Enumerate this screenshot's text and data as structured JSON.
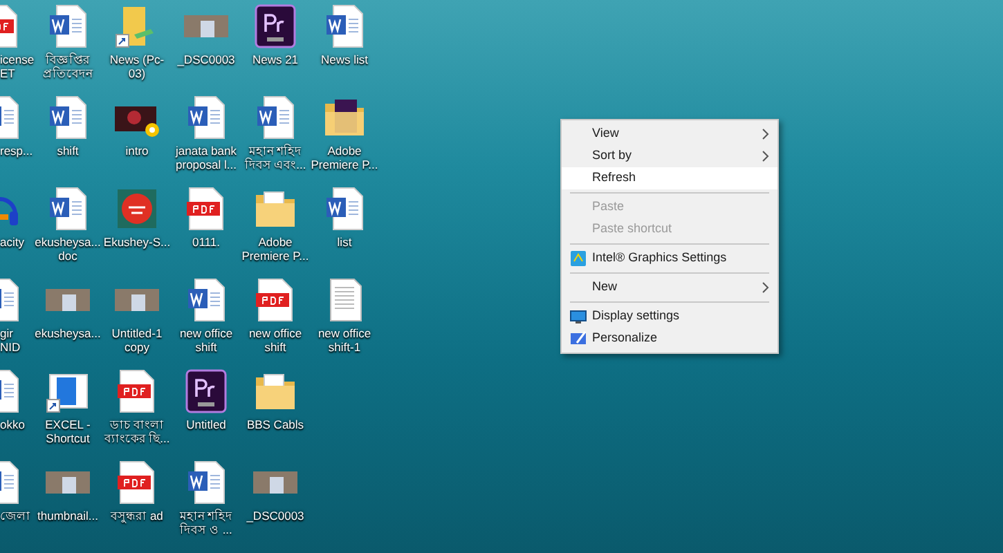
{
  "desktop_icons": [
    [
      {
        "kind": "pdf",
        "label": "icense ET"
      },
      {
        "kind": "word",
        "label": "বিজ্ঞপ্তির প্রতিবেদন"
      },
      {
        "kind": "shortcut-folder",
        "label": "News (Pc-03)"
      },
      {
        "kind": "photo",
        "label": "_DSC0003"
      },
      {
        "kind": "premiere",
        "label": "News 21"
      },
      {
        "kind": "word",
        "label": "News list"
      }
    ],
    [
      {
        "kind": "word",
        "label": "resp..."
      },
      {
        "kind": "word",
        "label": "shift"
      },
      {
        "kind": "video",
        "label": "intro"
      },
      {
        "kind": "word",
        "label": "janata bank proposal l..."
      },
      {
        "kind": "word",
        "label": "মহান শহিদ দিবস এবং..."
      },
      {
        "kind": "premiere-folder",
        "label": "Adobe Premiere P..."
      }
    ],
    [
      {
        "kind": "audio",
        "label": "acity"
      },
      {
        "kind": "word",
        "label": "ekusheysa... doc"
      },
      {
        "kind": "app",
        "label": "Ekushey-S..."
      },
      {
        "kind": "pdf",
        "label": "0111."
      },
      {
        "kind": "folder",
        "label": "Adobe Premiere P..."
      },
      {
        "kind": "word",
        "label": "list"
      }
    ],
    [
      {
        "kind": "word",
        "label": "gir NID"
      },
      {
        "kind": "photo",
        "label": "ekusheysa..."
      },
      {
        "kind": "photo",
        "label": "Untitled-1 copy"
      },
      {
        "kind": "word",
        "label": "new office shift"
      },
      {
        "kind": "pdf",
        "label": "new office shift"
      },
      {
        "kind": "text",
        "label": "new office shift-1"
      }
    ],
    [
      {
        "kind": "word",
        "label": "okko"
      },
      {
        "kind": "excel-shortcut",
        "label": "EXCEL - Shortcut"
      },
      {
        "kind": "pdf",
        "label": "ডাচ বাংলা ব্যাংকের ছি..."
      },
      {
        "kind": "premiere",
        "label": "Untitled"
      },
      {
        "kind": "folder",
        "label": "BBS Cabls"
      }
    ],
    [
      {
        "kind": "word",
        "label": "জেলা"
      },
      {
        "kind": "photo",
        "label": "thumbnail..."
      },
      {
        "kind": "pdf",
        "label": "বসুন্ধরা ad"
      },
      {
        "kind": "word",
        "label": "মহান শহিদ দিবস ও ..."
      },
      {
        "kind": "photo",
        "label": "_DSC0003"
      }
    ]
  ],
  "context_menu": [
    {
      "kind": "item",
      "label": "View",
      "submenu": true,
      "disabled": false,
      "selected": false
    },
    {
      "kind": "item",
      "label": "Sort by",
      "submenu": true,
      "disabled": false,
      "selected": false
    },
    {
      "kind": "item",
      "label": "Refresh",
      "submenu": false,
      "disabled": false,
      "selected": true
    },
    {
      "kind": "separator"
    },
    {
      "kind": "item",
      "label": "Paste",
      "submenu": false,
      "disabled": true,
      "selected": false
    },
    {
      "kind": "item",
      "label": "Paste shortcut",
      "submenu": false,
      "disabled": true,
      "selected": false
    },
    {
      "kind": "separator"
    },
    {
      "kind": "item",
      "label": "Intel® Graphics Settings",
      "has_icon": true,
      "submenu": false,
      "disabled": false,
      "selected": false
    },
    {
      "kind": "separator"
    },
    {
      "kind": "item",
      "label": "New",
      "submenu": true,
      "disabled": false,
      "selected": false
    },
    {
      "kind": "separator"
    },
    {
      "kind": "item",
      "label": "Display settings",
      "has_icon": true,
      "submenu": false,
      "disabled": false,
      "selected": false
    },
    {
      "kind": "item",
      "label": "Personalize",
      "has_icon": true,
      "submenu": false,
      "disabled": false,
      "selected": false
    }
  ]
}
